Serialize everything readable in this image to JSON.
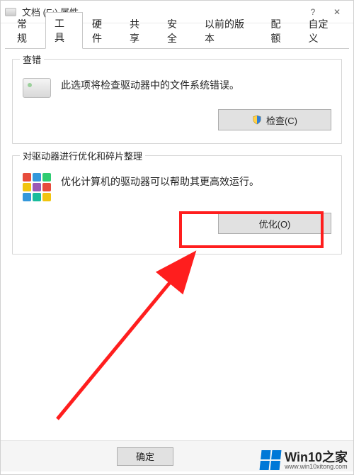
{
  "titlebar": {
    "title": "文档 (E:) 属性"
  },
  "tabs": [
    {
      "label": "常规"
    },
    {
      "label": "工具"
    },
    {
      "label": "硬件"
    },
    {
      "label": "共享"
    },
    {
      "label": "安全"
    },
    {
      "label": "以前的版本"
    },
    {
      "label": "配额"
    },
    {
      "label": "自定义"
    }
  ],
  "active_tab_index": 1,
  "group_check": {
    "legend": "查错",
    "desc": "此选项将检查驱动器中的文件系统错误。",
    "button_label": "检查(C)"
  },
  "group_optimize": {
    "legend": "对驱动器进行优化和碎片整理",
    "desc": "优化计算机的驱动器可以帮助其更高效运行。",
    "button_label": "优化(O)"
  },
  "dialog": {
    "ok_label": "确定"
  },
  "watermark": {
    "text": "Win10之家",
    "subtext": "www.win10xitong.com"
  },
  "colors": {
    "highlight": "#ff1e1e",
    "accent": "#0078d7"
  }
}
